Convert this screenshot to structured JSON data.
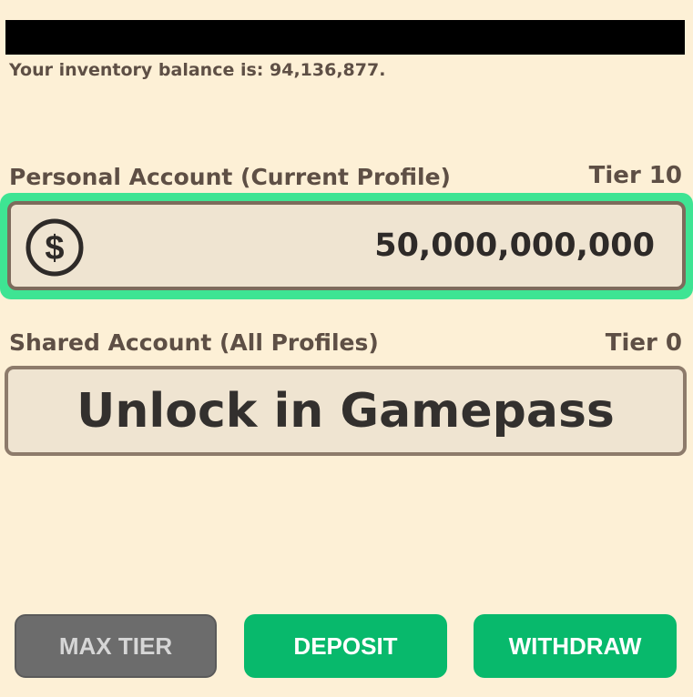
{
  "balance": {
    "text": "Your inventory balance is: 94,136,877."
  },
  "personal_account": {
    "label": "Personal Account (Current Profile)",
    "tier": "Tier 10",
    "amount": "50,000,000,000",
    "icon": "dollar-coin-icon",
    "selected": true,
    "highlight_color": "#3ee493"
  },
  "shared_account": {
    "label": "Shared Account (All Profiles)",
    "tier": "Tier 0",
    "locked_text": "Unlock in Gamepass"
  },
  "buttons": {
    "max_tier": {
      "label": "MAX TIER",
      "color": "#6c6c6c",
      "disabled": true
    },
    "deposit": {
      "label": "DEPOSIT",
      "color": "#08b96c"
    },
    "withdraw": {
      "label": "WITHDRAW",
      "color": "#08b96c"
    }
  }
}
